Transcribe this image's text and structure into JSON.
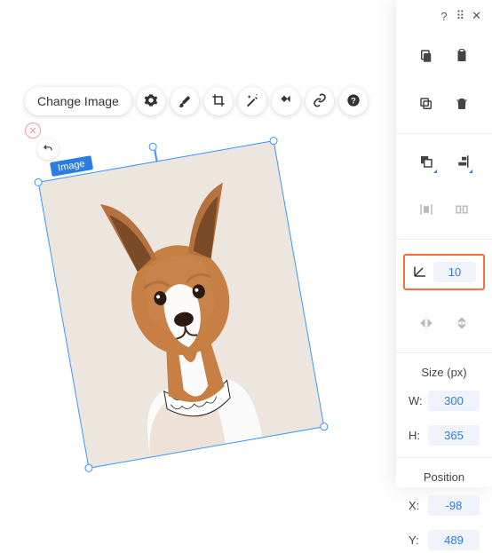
{
  "toolbar": {
    "change_label": "Change Image"
  },
  "selection": {
    "label": "Image"
  },
  "panel": {
    "rotation_value": "10",
    "size": {
      "label": "Size (px)",
      "w_label": "W:",
      "w_value": "300",
      "h_label": "H:",
      "h_value": "365"
    },
    "position": {
      "label": "Position",
      "x_label": "X:",
      "x_value": "-98",
      "y_label": "Y:",
      "y_value": "489"
    }
  }
}
